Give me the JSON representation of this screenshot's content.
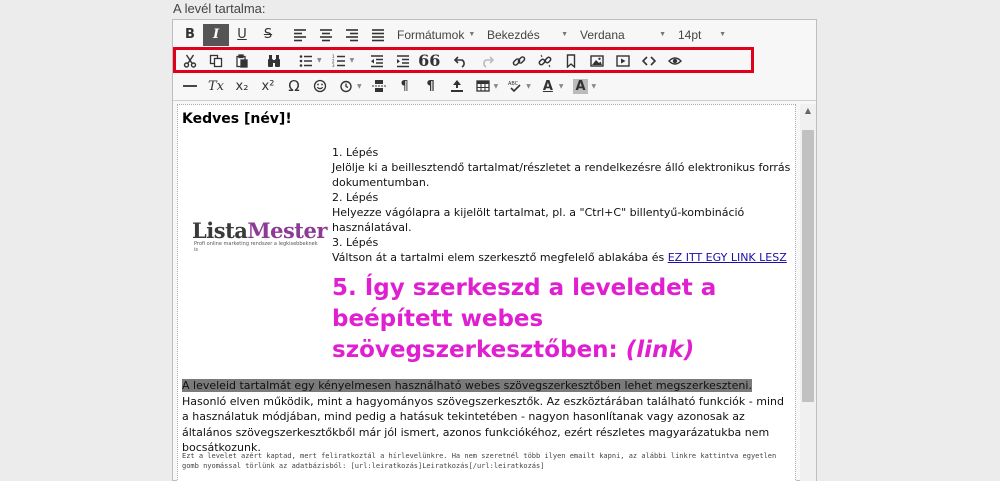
{
  "section_label": "A levél tartalma:",
  "toolbar": {
    "row1": {
      "bold": "B",
      "italic": "I",
      "underline": "U",
      "strike": "S",
      "formats": "Formátumok",
      "paragraph": "Bekezdés",
      "font": "Verdana",
      "size": "14pt"
    },
    "row2": {
      "quote": "66"
    },
    "row3": {
      "clear_format": "Tx",
      "subscript": "x₂",
      "superscript": "x²",
      "omega": "Ω",
      "pilcrow": "¶",
      "spell": "ABC",
      "text_color": "A",
      "bg_color": "A"
    },
    "colors": {
      "highlight_border": "#e0001b",
      "active_btn": "#555555"
    }
  },
  "content": {
    "greeting": "Kedves [név]!",
    "logo": {
      "lista": "Lista",
      "mester": "Mester",
      "tagline": "Profi online marketing rendszer a legkisebbeknek is"
    },
    "steps": [
      {
        "title": "1. Lépés",
        "text": "Jelölje ki a beillesztendő tartalmat/részletet a rendelkezésre álló elektronikus forrás dokumentumban."
      },
      {
        "title": "2. Lépés",
        "text": "Helyezze vágólapra a kijelölt tartalmat, pl. a \"Ctrl+C\" billentyű-kombináció használatával."
      },
      {
        "title": "3. Lépés",
        "text": "Váltson át a tartalmi elem szerkesztő megfelelő ablakába és ",
        "link": "EZ ITT EGY LINK LESZ"
      }
    ],
    "heading": {
      "main": "5. Így szerkeszd a leveledet a beépített webes szövegszerkesztőben: ",
      "italic": "(link)",
      "color": "#e020d0"
    },
    "paragraph": {
      "highlighted": "A leveleid tartalmát egy kényelmesen használható webes szövegszerkesztőben lehet megszerkeszteni.",
      "rest": " Hasonló elven működik, mint a hagyományos szövegszerkesztők. Az eszköztárában található funkciók - mind a használatuk módjában, mind pedig a hatásuk tekintetében - nagyon hasonlítanak vagy azonosak az általános szövegszerkesztőkből már jól ismert, azonos funkciókéhoz, ezért részletes magyarázatukba nem bocsátkozunk."
    },
    "footer": "Ezt a levelet azért kaptad, mert feliratkoztál a hírlevelünkre. Ha nem szeretnél több ilyen emailt kapni, az alábbi linkre kattintva egyetlen gomb nyomással törlünk az adatbázisból: [url:leiratkozás]Leiratkozás[/url:leiratkozás]"
  }
}
